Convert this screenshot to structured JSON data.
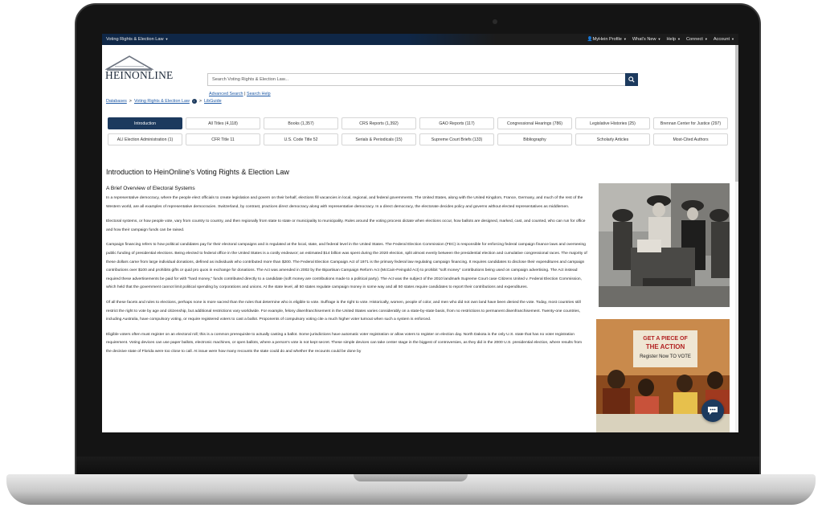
{
  "topbar": {
    "collection": "Voting Rights & Election Law",
    "nav": [
      "MyHein Profile",
      "What's New",
      "Help",
      "Connect",
      "Account"
    ]
  },
  "logo": {
    "text": "HEINONLINE"
  },
  "search": {
    "placeholder": "Search Voting Rights & Election Law..."
  },
  "links": {
    "advanced": "Advanced Search",
    "separator": "|",
    "help": "Search Help"
  },
  "breadcrumb": {
    "databases": "Databases",
    "sep": ">",
    "collection": "Voting Rights & Election Law",
    "libguide": "LibGuide"
  },
  "tabs_row1": [
    "Introduction",
    "All Titles (4,118)",
    "Books (1,357)",
    "CRS Reports (1,392)",
    "GAO Reports (117)",
    "Congressional Hearings (786)",
    "Legislative Histories (25)",
    "Brennan Center for Justice (297)"
  ],
  "tabs_row2": [
    "ALI Election Administration (1)",
    "CFR Title 11",
    "U.S. Code Title 52",
    "Serials & Periodicals (15)",
    "Supreme Court Briefs (133)",
    "Bibliography",
    "Scholarly Articles",
    "Most-Cited Authors"
  ],
  "content": {
    "title": "Introduction to HeinOnline's Voting Rights & Election Law",
    "subtitle": "A Brief Overview of Electoral Systems",
    "p1": "In a representative democracy, where the people elect officials to create legislation and govern on their behalf, elections fill vacancies in local, regional, and federal governments. The United States, along with the United Kingdom, France, Germany, and much of the rest of the Western world, are all examples of representative democracies. Switzerland, by contrast, practices direct democracy along with representative democracy. In a direct democracy, the electorate decides policy and governs without elected representatives as middlemen.",
    "p2": "Electoral systems, or how people vote, vary from country to country, and then regionally from state to state or municipality to municipality. Rules around the voting process dictate when elections occur, how ballots are designed, marked, cast, and counted, who can run for office and how their campaign funds can be raised.",
    "p3": "Campaign financing refers to how political candidates pay for their electoral campaigns and is regulated at the local, state, and federal level in the United States. The Federal Election Commission (FEC) is responsible for enforcing federal campaign finance laws and overseeing public funding of presidential elections. Being elected to federal office in the United States is a costly endeavor; an estimated $14 billion was spent during the 2020 election, split almost evenly between the presidential election and cumulative congressional races. The majority of these dollars came from large individual donations, defined as individuals who contributed more than $200. The Federal Election Campaign Act of 1971 is the primary federal law regulating campaign financing. It requires candidates to disclose their expenditures and campaign contributions over $100 and prohibits gifts or quid pro quos in exchange for donations. The Act was amended in 2002 by the Bipartisan Campaign Reform Act (McCain-Feingold Act) to prohibit \"soft money\" contributions being used on campaign advertising. The Act instead required these advertisements be paid for with \"hard money,\" funds contributed directly to a candidate (soft money are contributions made to a political party). The Act was the subject of the 2010 landmark Supreme Court case Citizens United v. Federal Election Commission, which held that the government cannot limit political spending by corporations and unions. At the state level, all 50 states regulate campaign money in some way and all 50 states require candidates to report their contributions and expenditures.",
    "p4": "Of all these facets and rules to elections, perhaps none is more sacred than the rules that determine who is eligible to vote. Suffrage is the right to vote. Historically, women, people of color, and men who did not own land have been denied the vote. Today, most countries still restrict the right to vote by age and citizenship, but additional restrictions vary worldwide. For example, felony disenfranchisement in the United States varies considerably on a state-by-state basis, from no restrictions to permanent disenfranchisement. Twenty-one countries, including Australia, have compulsory voting, or require registered voters to cast a ballot. Proponents of compulsory voting cite a much higher voter turnout when such a system is enforced.",
    "p5": "Eligible voters often must register on an electoral roll; this is a common prerequisite to actually casting a ballot. Some jurisdictions have automatic voter registration or allow voters to register on election day. North Dakota is the only U.S. state that has no voter registration requirement. Voting devices can use paper ballots, electronic machines, or open ballots, where a person's vote is not kept secret. These simple devices can take center stage in the biggest of controversies, as they did in the 2000 U.S. presidential election, where results from the decisive state of Florida were too close to call. At issue were how many recounts the state could do and whether the recounts could be done by"
  },
  "photo2_sign": {
    "line1": "GET A PIECE OF",
    "line2": "THE ACTION",
    "line3": "Register Now TO VOTE"
  }
}
